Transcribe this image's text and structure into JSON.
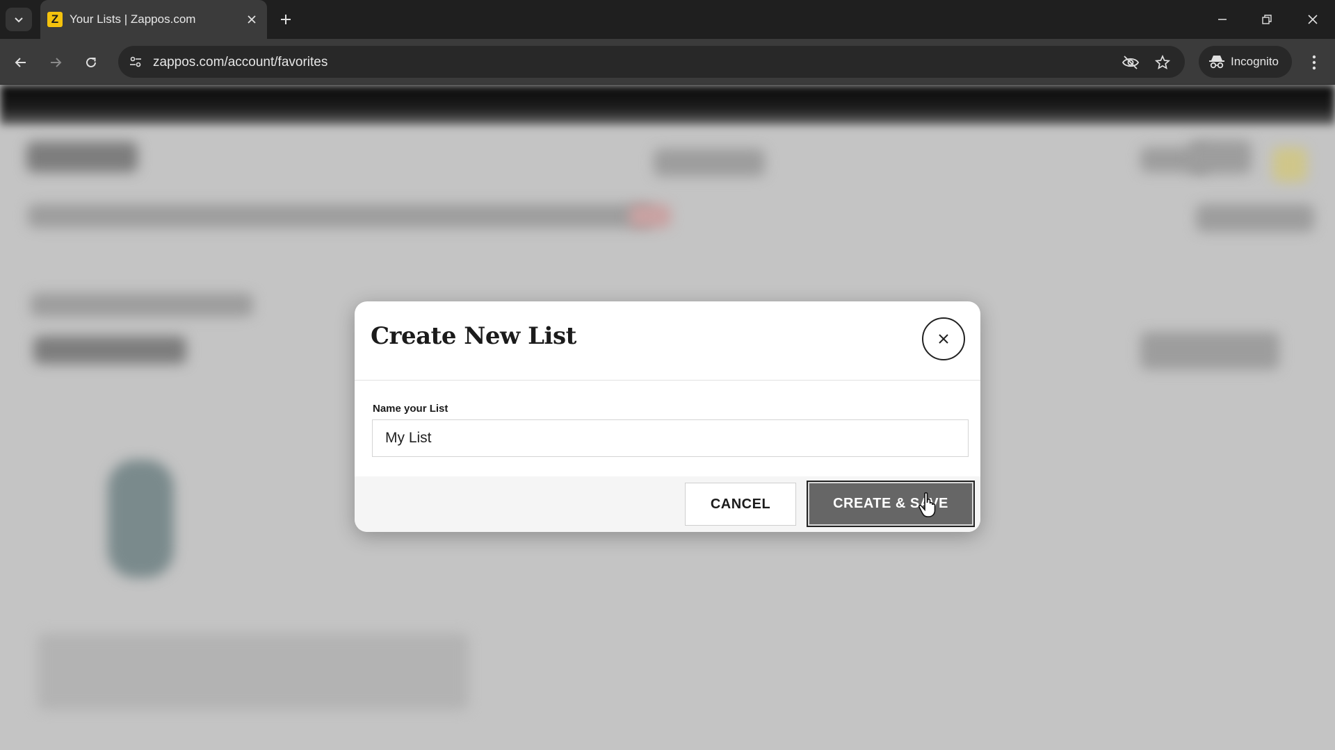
{
  "browser": {
    "tab": {
      "favicon_letter": "Z",
      "title": "Your Lists | Zappos.com"
    },
    "url": "zappos.com/account/favorites",
    "profile_label": "Incognito",
    "icons": [
      "tab-search-icon",
      "close-icon",
      "plus-icon",
      "minimize-icon",
      "restore-icon",
      "window-close-icon",
      "back-arrow-icon",
      "forward-arrow-icon",
      "reload-icon",
      "site-settings-icon",
      "eye-slash-icon",
      "star-icon",
      "incognito-icon",
      "kebab-menu-icon"
    ]
  },
  "modal": {
    "title": "Create New List",
    "field_label": "Name your List",
    "field_value": "My List",
    "cancel_label": "CANCEL",
    "save_label": "CREATE & SAVE"
  },
  "colors": {
    "chrome_dark": "#1f1f1f",
    "chrome_toolbar": "#3b3b3b",
    "favicon_yellow": "#f4c20d",
    "overlay_gray": "#c4c4c4",
    "save_button": "#666666"
  }
}
